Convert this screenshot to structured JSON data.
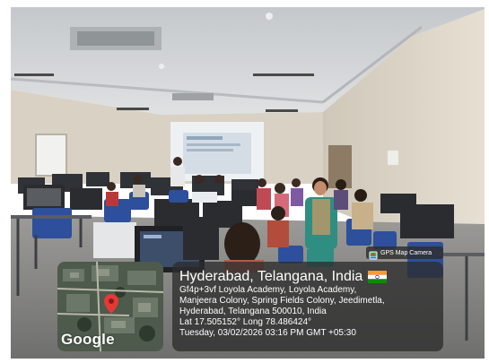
{
  "overlay": {
    "badge": {
      "icon": "gps-camera-icon",
      "text": "GPS Map Camera"
    },
    "map": {
      "logo": "Google",
      "pin_color": "#e53935"
    },
    "card": {
      "title": "Hyderabad, Telangana, India",
      "flag": "india-flag-icon",
      "address_line_1": "Gf4p+3vf Loyola Academy, Loyola Academy,",
      "address_line_2": "Manjeera Colony, Spring Fields Colony, Jeedimetla,",
      "address_line_3": "Hyderabad, Telangana 500010, India",
      "coordinates": "Lat 17.505152° Long 78.486424°",
      "timestamp": "Tuesday, 03/02/2026 03:16 PM GMT +05:30"
    }
  }
}
